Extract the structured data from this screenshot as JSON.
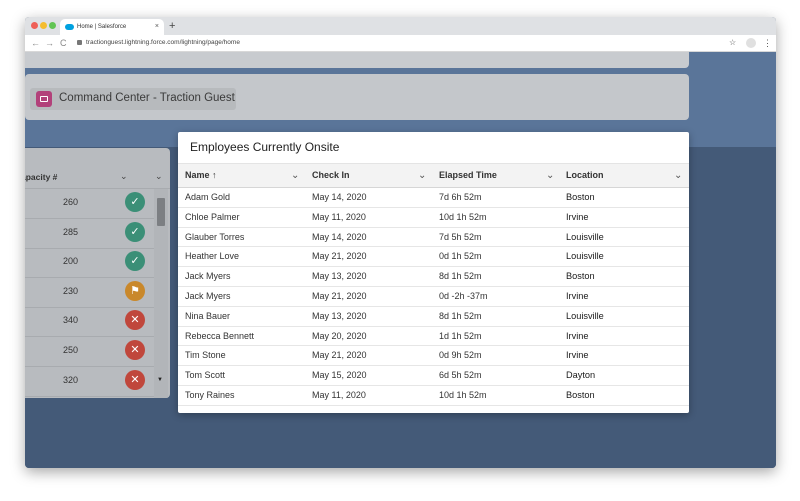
{
  "browser": {
    "tab_title": "Home | Salesforce",
    "tab_close": "×",
    "new_tab": "+",
    "back": "←",
    "forward": "→",
    "reload": "C",
    "url": "tractionguest.lightning.force.com/lightning/page/home",
    "bookmark": "☆",
    "menu": "⋮"
  },
  "header": {
    "title": "Command Center - Traction Guest"
  },
  "left_table": {
    "column_label": "apacity #",
    "rows": [
      {
        "value": "260",
        "status": "ok"
      },
      {
        "value": "285",
        "status": "ok"
      },
      {
        "value": "200",
        "status": "ok"
      },
      {
        "value": "230",
        "status": "warn"
      },
      {
        "value": "340",
        "status": "bad"
      },
      {
        "value": "250",
        "status": "bad"
      },
      {
        "value": "320",
        "status": "bad"
      }
    ],
    "status_glyphs": {
      "ok": "✓",
      "warn": "⚑",
      "bad": "✕"
    },
    "chevron": "⌄",
    "scroll_down": "▼"
  },
  "employees": {
    "title": "Employees Currently Onsite",
    "columns": [
      "Name ↑",
      "Check In",
      "Elapsed Time",
      "Location"
    ],
    "chevron": "⌄",
    "rows": [
      [
        "Adam Gold",
        "May 14, 2020",
        "7d 6h 52m",
        "Boston"
      ],
      [
        "Chloe Palmer",
        "May 11, 2020",
        "10d 1h 52m",
        "Irvine"
      ],
      [
        "Glauber Torres",
        "May 14, 2020",
        "7d 5h 52m",
        "Louisville"
      ],
      [
        "Heather Love",
        "May 21, 2020",
        "0d 1h 52m",
        "Louisville"
      ],
      [
        "Jack Myers",
        "May 13, 2020",
        "8d 1h 52m",
        "Boston"
      ],
      [
        "Jack Myers",
        "May 21, 2020",
        "0d -2h -37m",
        "Irvine"
      ],
      [
        "Nina Bauer",
        "May 13, 2020",
        "8d 1h 52m",
        "Louisville"
      ],
      [
        "Rebecca Bennett",
        "May 20, 2020",
        "1d 1h 52m",
        "Irvine"
      ],
      [
        "Tim Stone",
        "May 21, 2020",
        "0d 9h 52m",
        "Irvine"
      ],
      [
        "Tom Scott",
        "May 15, 2020",
        "6d 5h 52m",
        "Dayton"
      ],
      [
        "Tony Raines",
        "May 11, 2020",
        "10d 1h 52m",
        "Boston"
      ]
    ]
  },
  "colors": {
    "page_bg": "#445a78",
    "ok": "#3b8f77",
    "warn": "#c9882b",
    "bad": "#c0473c",
    "icon_pink": "#b2417a"
  }
}
